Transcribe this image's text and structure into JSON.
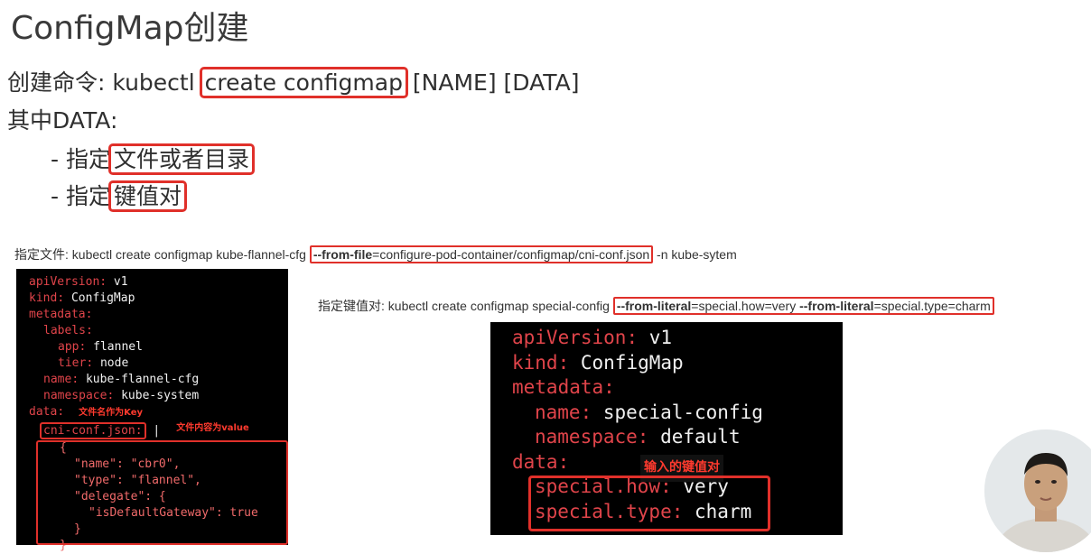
{
  "slide": {
    "title": "ConfigMap创建",
    "cmd_prefix": "创建命令: kubectl ",
    "cmd_highlight": "create configmap",
    "cmd_suffix": " [NAME] [DATA]",
    "data_label": "其中DATA:",
    "item1_prefix": "- 指定",
    "item1_highlight": "文件或者目录",
    "item2_prefix": "- 指定",
    "item2_highlight": "键值对"
  },
  "file_cmd": {
    "prefix": "指定文件: kubectl create configmap kube-flannel-cfg ",
    "flag": "--from-file",
    "value": "=configure-pod-container/configmap/cni-conf.json",
    "suffix": " -n kube-sytem"
  },
  "literal_cmd": {
    "prefix": "指定键值对: kubectl create configmap special-config ",
    "flag1": "--from-literal",
    "value1": "=special.how=very ",
    "flag2": "--from-literal",
    "value2": "=special.type=charm"
  },
  "yaml1": {
    "l1k": "apiVersion",
    "l1v": " v1",
    "l2k": "kind",
    "l2v": " ConfigMap",
    "l3k": "metadata",
    "l4k": "labels",
    "l5k": "app",
    "l5v": " flannel",
    "l6k": "tier",
    "l6v": " node",
    "l7k": "name",
    "l7v": " kube-flannel-cfg",
    "l8k": "namespace",
    "l8v": " kube-system",
    "l9k": "data",
    "note_key": "文件名作为Key",
    "l10k": "cni-conf.json:",
    "l10v": " |",
    "note_value": "文件内容为value",
    "l11": "{",
    "l12": "\"name\": \"cbr0\",",
    "l13": "\"type\": \"flannel\",",
    "l14": "\"delegate\": {",
    "l15": "\"isDefaultGateway\": true",
    "l16": "}",
    "l17": "}"
  },
  "yaml2": {
    "l1k": "apiVersion",
    "l1v": " v1",
    "l2k": "kind",
    "l2v": " ConfigMap",
    "l3k": "metadata",
    "l4k": "name",
    "l4v": " special-config",
    "l5k": "namespace",
    "l5v": " default",
    "l6k": "data",
    "note": "输入的键值对",
    "l7k": "special.how",
    "l7v": " very",
    "l8k": "special.type",
    "l8v": " charm"
  }
}
